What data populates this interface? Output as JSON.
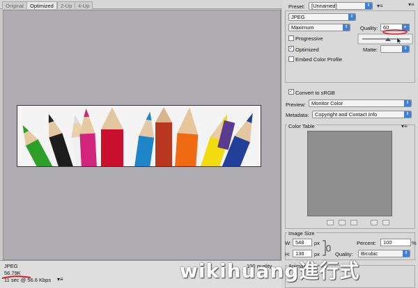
{
  "tabs": [
    "Original",
    "Optimized",
    "2-Up",
    "4-Up"
  ],
  "status": {
    "format": "JPEG",
    "size": "56.79K",
    "download": "11 sec @ 56.6 Kbps",
    "quality": "100 quality"
  },
  "panel": {
    "preset_label": "Preset:",
    "preset_value": "[Unnamed]",
    "format_value": "JPEG",
    "compression_value": "Maximum",
    "quality_label": "Quality:",
    "quality_value": "60",
    "quality_slider_fraction": 0.6,
    "progressive_label": "Progressive",
    "progressive_checked": false,
    "optimized_label": "Optimized",
    "optimized_checked": true,
    "matte_label": "Matte:",
    "embed_label": "Embed Color Profile",
    "embed_checked": false,
    "srgb_label": "Convert to sRGB",
    "srgb_checked": true,
    "preview_label": "Preview:",
    "preview_value": "Monitor Color",
    "metadata_label": "Metadata:",
    "metadata_value": "Copyright and Contact Info",
    "color_table_title": "Color Table",
    "image_size_title": "Image Size",
    "w_label": "W:",
    "w_value": "548",
    "h_label": "H:",
    "h_value": "138",
    "px": "px",
    "percent_label": "Percent:",
    "percent_value": "100",
    "percent_unit": "%",
    "quality2_label": "Quality:",
    "quality2_value": "Bicubic",
    "animation_title": "Animation"
  },
  "watermark": "wikihuang進行式",
  "colors": {
    "accent": "#3f7fd6",
    "annotation_red": "#d21f1f",
    "canvas_gray": "#aeacb0"
  }
}
